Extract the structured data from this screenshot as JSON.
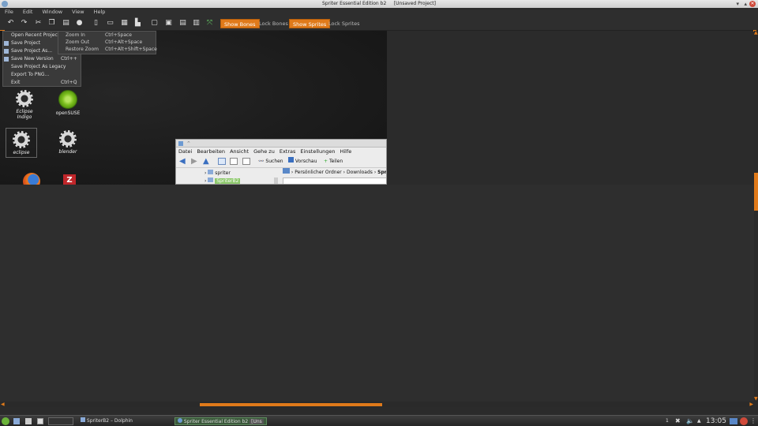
{
  "window": {
    "title": "Spriter Essential Edition b2",
    "project": "[Unsaved Project]"
  },
  "menubar": {
    "items": [
      "File",
      "Edit",
      "Window",
      "View",
      "Help"
    ]
  },
  "toolbar": {
    "show_bones": "Show Bones",
    "lock_bones": "Lock Bones",
    "show_sprites": "Show Sprites",
    "lock_sprites": "Lock Sprites"
  },
  "file_menu": {
    "items": [
      {
        "label": "Open Recent Project",
        "shortcut": ""
      },
      {
        "label": "Save Project",
        "shortcut": ""
      },
      {
        "label": "Save Project As...",
        "shortcut": ""
      },
      {
        "label": "Save New Version",
        "shortcut": "Ctrl++"
      },
      {
        "label": "Save Project As Legacy",
        "shortcut": ""
      },
      {
        "label": "Export To PNG...",
        "shortcut": ""
      },
      {
        "label": "Exit",
        "shortcut": "Ctrl+Q"
      }
    ]
  },
  "view_menu": {
    "items": [
      {
        "label": "Zoom In",
        "shortcut": "Ctrl+Space"
      },
      {
        "label": "Zoom Out",
        "shortcut": "Ctrl+Alt+Space"
      },
      {
        "label": "Restore Zoom",
        "shortcut": "Ctrl+Alt+Shift+Space"
      }
    ]
  },
  "desktop": {
    "icons": [
      {
        "label": "Eclipse Indigo",
        "icon": "gear-icon"
      },
      {
        "label": "openSUSE",
        "icon": "opensuse-icon"
      },
      {
        "label": "eclipse",
        "icon": "gear-icon"
      },
      {
        "label": "blender",
        "icon": "gear-icon"
      },
      {
        "label": "",
        "icon": "firefox-icon"
      },
      {
        "label": "",
        "icon": "filezilla-icon"
      }
    ]
  },
  "dolphin": {
    "menu": [
      "Datei",
      "Bearbeiten",
      "Ansicht",
      "Gehe zu",
      "Extras",
      "Einstellungen",
      "Hilfe"
    ],
    "toolbar": {
      "search": "Suchen",
      "preview": "Vorschau",
      "share": "Teilen"
    },
    "tree": [
      "spriter",
      "SpriterB2"
    ],
    "breadcrumb": [
      "Persönlicher Ordner",
      "Downloads",
      "Spr"
    ]
  },
  "taskbar": {
    "tasks": [
      "SpriterB2 – Dolphin",
      "Spriter Essential Edition b2",
      "[Uns"
    ],
    "desktop_number": "1",
    "clock": "13:05"
  },
  "colors": {
    "accent": "#e07a1a",
    "background": "#2b2b2b"
  }
}
